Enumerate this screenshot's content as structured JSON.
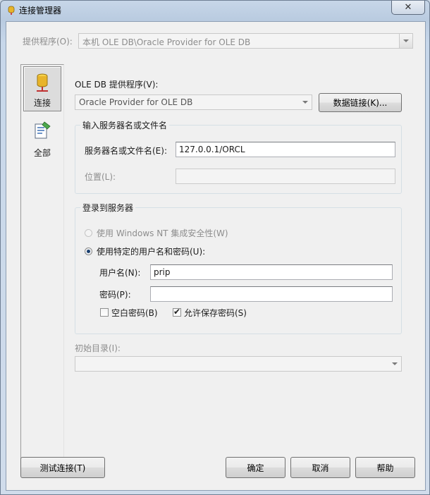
{
  "window": {
    "title": "连接管理器",
    "close_glyph": "✕"
  },
  "provider": {
    "label": "提供程序(O):",
    "value": "本机 OLE DB\\Oracle Provider for OLE DB"
  },
  "nav": {
    "items": [
      {
        "label": "连接",
        "icon": "database-connect-icon",
        "selected": true
      },
      {
        "label": "全部",
        "icon": "properties-list-icon",
        "selected": false
      }
    ]
  },
  "oledb": {
    "label": "OLE DB 提供程序(V):",
    "value": "Oracle Provider for OLE DB",
    "data_link_button": "数据链接(K)..."
  },
  "server_group": {
    "title": "输入服务器名或文件名",
    "server_label": "服务器名或文件名(E):",
    "server_value": "127.0.0.1/ORCL",
    "location_label": "位置(L):",
    "location_value": ""
  },
  "login_group": {
    "title": "登录到服务器",
    "windows_auth_label": "使用 Windows NT 集成安全性(W)",
    "specific_auth_label": "使用特定的用户名和密码(U):",
    "username_label": "用户名(N):",
    "username_value": "prip",
    "password_label": "密码(P):",
    "password_value": "",
    "blank_password_label": "空白密码(B)",
    "blank_password_checked": false,
    "save_password_label": "允许保存密码(S)",
    "save_password_checked": true
  },
  "catalog": {
    "label": "初始目录(I):",
    "value": ""
  },
  "buttons": {
    "test": "测试连接(T)",
    "ok": "确定",
    "cancel": "取消",
    "help": "帮助"
  }
}
